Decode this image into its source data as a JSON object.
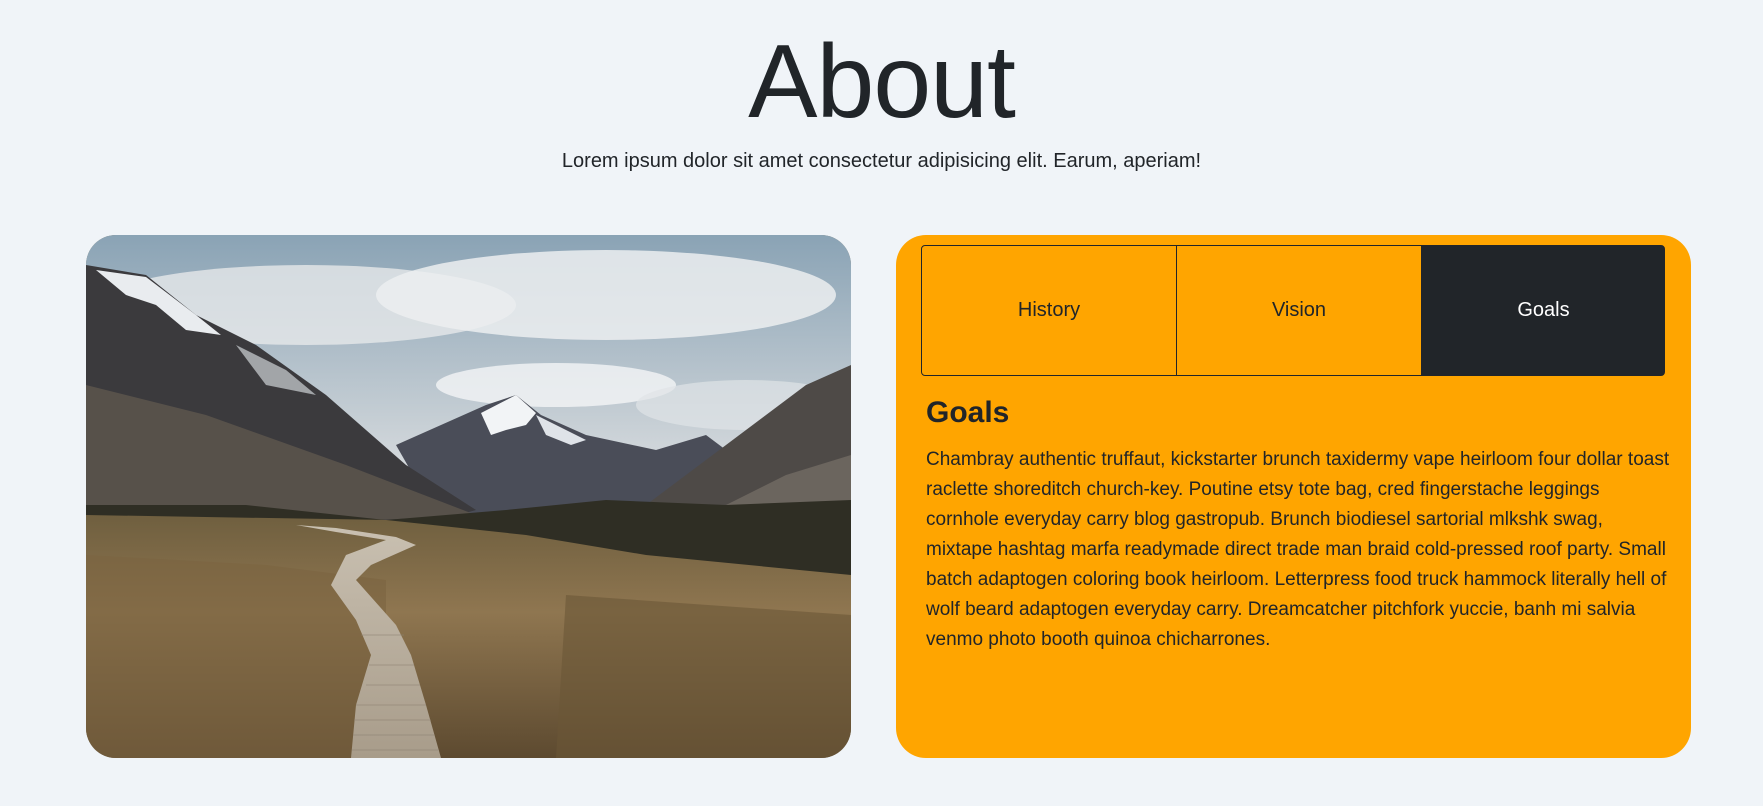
{
  "header": {
    "title": "About",
    "subtitle": "Lorem ipsum dolor sit amet consectetur adipisicing elit. Earum, aperiam!"
  },
  "photo": {
    "description_icon": "landscape-photo"
  },
  "tabs": [
    {
      "label": "History",
      "active": false
    },
    {
      "label": "Vision",
      "active": false
    },
    {
      "label": "Goals",
      "active": true
    }
  ],
  "panel": {
    "heading": "Goals",
    "body": "Chambray authentic truffaut, kickstarter brunch taxidermy vape heirloom four dollar toast raclette shoreditch church-key. Poutine etsy tote bag, cred fingerstache leggings cornhole everyday carry blog gastropub. Brunch biodiesel sartorial mlkshk swag, mixtape hashtag marfa readymade direct trade man braid cold-pressed roof party. Small batch adaptogen coloring book heirloom. Letterpress food truck hammock literally hell of wolf beard adaptogen everyday carry. Dreamcatcher pitchfork yuccie, banh mi salvia venmo photo booth quinoa chicharrones."
  },
  "colors": {
    "background": "#f0f4f8",
    "accent": "#ffa500",
    "dark": "#212529",
    "text_light": "#ffffff"
  }
}
